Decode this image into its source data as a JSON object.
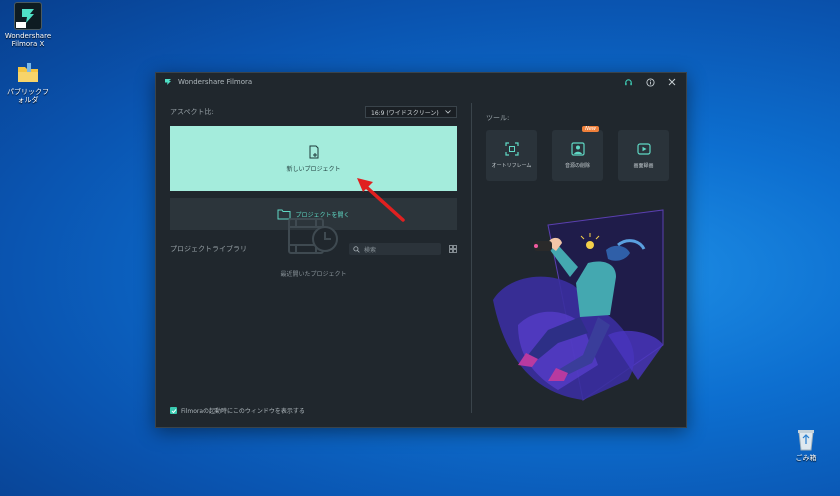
{
  "desktop": {
    "icons": [
      {
        "label": "Wondershare Filmora X",
        "icon": "filmora-app-icon"
      },
      {
        "label": "パブリックフォルダ",
        "icon": "folder-icon"
      },
      {
        "label": "ごみ箱",
        "icon": "recycle-bin-icon"
      }
    ]
  },
  "window": {
    "title": "Wondershare Filmora",
    "controls": [
      "headset-support-icon",
      "info-icon",
      "close-icon"
    ]
  },
  "left": {
    "aspect_label": "アスペクト比:",
    "aspect_value": "16:9 (ワイドスクリーン)",
    "new_project_label": "新しいプロジェクト",
    "open_project_label": "プロジェクトを開く",
    "library_label": "プロジェクトライブラリ",
    "search_placeholder": "検索",
    "recent_label": "最近開いたプロジェクト",
    "startup_checkbox_label": "Filmoraの起動時にこのウィンドウを表示する",
    "startup_checked": true
  },
  "tools": {
    "label": "ツール:",
    "items": [
      {
        "label": "オートリフレーム",
        "icon": "auto-reframe-icon"
      },
      {
        "label": "音源の削除",
        "icon": "audio-remove-icon",
        "badge": "New"
      },
      {
        "label": "画面録画",
        "icon": "screen-record-icon"
      }
    ]
  },
  "colors": {
    "new_project_bg": "#a4ecdc",
    "accent": "#39c9b0",
    "window_bg": "#20272d",
    "annotation_arrow": "#e02020"
  }
}
